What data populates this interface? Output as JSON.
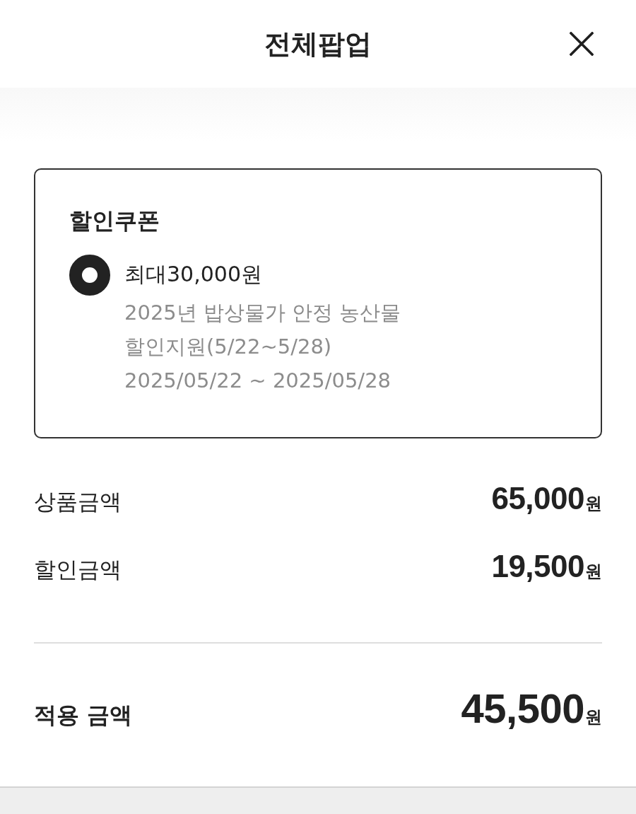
{
  "header": {
    "title": "전체팝업"
  },
  "coupon": {
    "title": "할인쿠폰",
    "options": [
      {
        "label": "최대30,000원",
        "description": "2025년 밥상물가 안정 농산물 할인지원(5/22~5/28)",
        "period": "2025/05/22 ~ 2025/05/28",
        "selected": true
      }
    ]
  },
  "summary": {
    "rows": [
      {
        "label": "상품금액",
        "amount": "65,000",
        "unit": "원"
      },
      {
        "label": "할인금액",
        "amount": "19,500",
        "unit": "원"
      }
    ],
    "total": {
      "label": "적용 금액",
      "amount": "45,500",
      "unit": "원"
    }
  }
}
